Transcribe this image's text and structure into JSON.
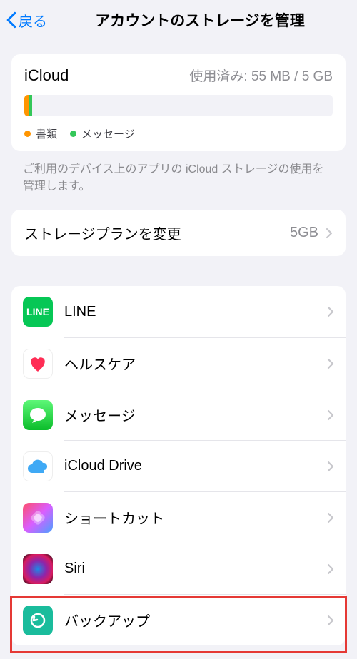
{
  "header": {
    "back_label": "戻る",
    "title": "アカウントのストレージを管理"
  },
  "icloud": {
    "title": "iCloud",
    "usage_text": "使用済み: 55 MB / 5 GB",
    "legend": {
      "docs": "書類",
      "messages": "メッセージ"
    }
  },
  "description": "ご利用のデバイス上のアプリの iCloud ストレージの使用を管理します。",
  "plan": {
    "label": "ストレージプランを変更",
    "value": "5GB"
  },
  "apps": {
    "line": "LINE",
    "health": "ヘルスケア",
    "messages": "メッセージ",
    "icloud_drive": "iCloud Drive",
    "shortcuts": "ショートカット",
    "siri": "Siri",
    "backup": "バックアップ"
  }
}
